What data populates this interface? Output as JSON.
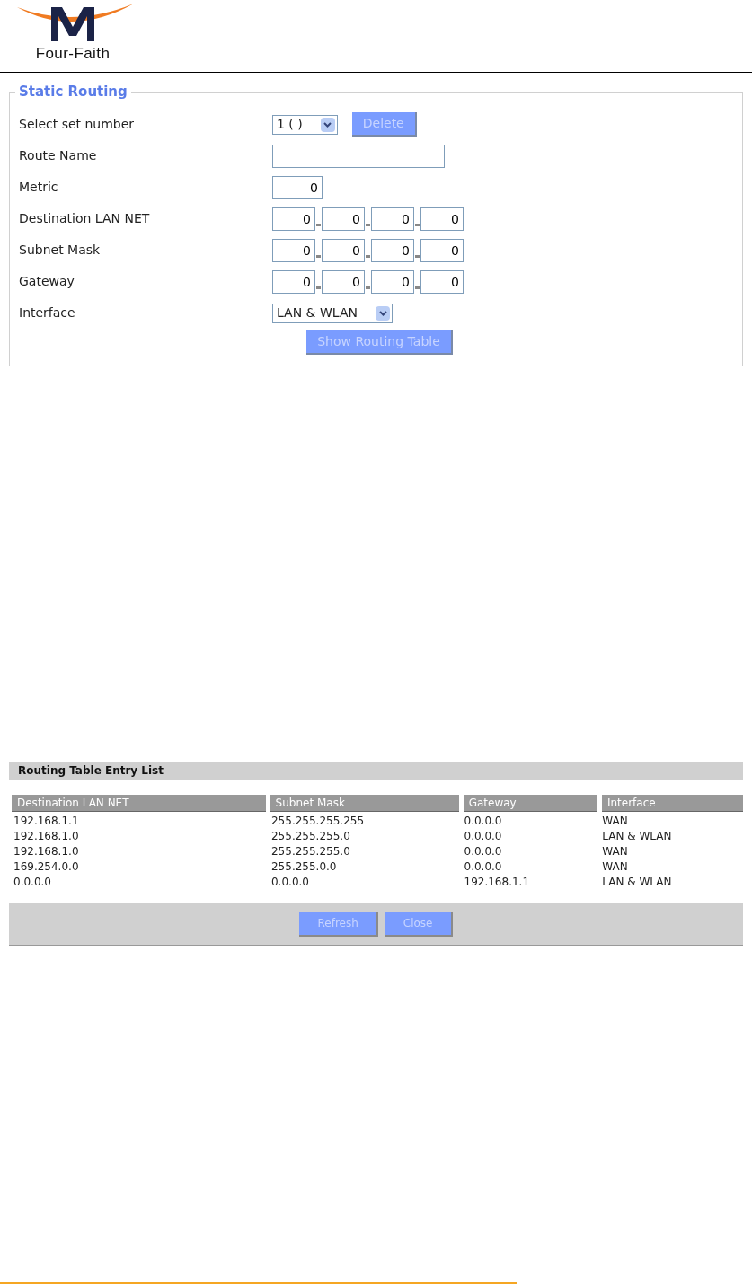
{
  "logo": {
    "name": "Four-Faith"
  },
  "static_routing": {
    "title": "Static Routing",
    "fields": [
      {
        "kind": "select",
        "label": "Select set number",
        "value": "1 ( )",
        "button": "Delete"
      },
      {
        "kind": "text",
        "label": "Route Name"
      },
      {
        "kind": "number",
        "label": "Metric",
        "value": "0"
      },
      {
        "kind": "ip",
        "label": "Destination LAN NET",
        "octets": [
          "0",
          "0",
          "0",
          "0"
        ]
      },
      {
        "kind": "ip",
        "label": "Subnet Mask",
        "octets": [
          "0",
          "0",
          "0",
          "0"
        ]
      },
      {
        "kind": "ip",
        "label": "Gateway",
        "octets": [
          "0",
          "0",
          "0",
          "0"
        ]
      },
      {
        "kind": "select",
        "label": "Interface",
        "value": "LAN & WLAN"
      }
    ],
    "button": "Show Routing Table"
  },
  "routing_table": {
    "title": "Routing Table Entry List",
    "columns": [
      "Destination LAN NET",
      "Subnet Mask",
      "Gateway",
      "Interface"
    ],
    "rows": [
      [
        "192.168.1.1",
        "255.255.255.255",
        "0.0.0.0",
        "WAN"
      ],
      [
        "192.168.1.0",
        "255.255.255.0",
        "0.0.0.0",
        "LAN & WLAN"
      ],
      [
        "192.168.1.0",
        "255.255.255.0",
        "0.0.0.0",
        "WAN"
      ],
      [
        "169.254.0.0",
        "255.255.0.0",
        "0.0.0.0",
        "WAN"
      ],
      [
        "0.0.0.0",
        "0.0.0.0",
        "192.168.1.1",
        "LAN & WLAN"
      ]
    ],
    "buttons": [
      "Refresh",
      "Close"
    ]
  }
}
